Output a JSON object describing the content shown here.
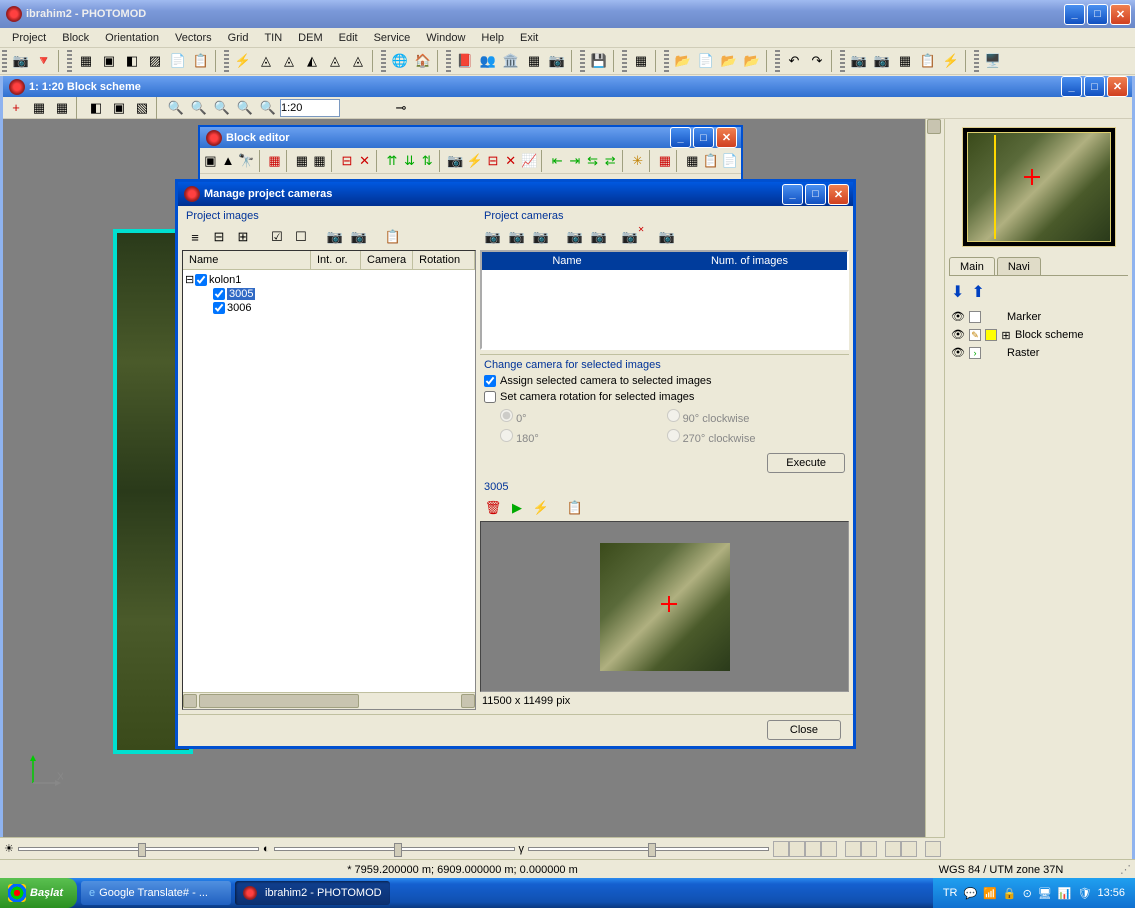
{
  "app": {
    "title": "ibrahim2 - PHOTOMOD"
  },
  "menu": {
    "items": [
      "Project",
      "Block",
      "Orientation",
      "Vectors",
      "Grid",
      "TIN",
      "DEM",
      "Edit",
      "Service",
      "Window",
      "Help",
      "Exit"
    ]
  },
  "block_scheme": {
    "title": "1: 1:20 Block scheme",
    "scale_value": "1:20"
  },
  "block_editor": {
    "title": "Block editor"
  },
  "mpc": {
    "title": "Manage project cameras",
    "left_label": "Project images",
    "tree_headers": [
      "Name",
      "Int. or.",
      "Camera",
      "Rotation"
    ],
    "tree": {
      "kolon": "kolon1",
      "items": [
        "3005",
        "3006"
      ],
      "selected": "3005"
    },
    "right_label": "Project cameras",
    "cam_headers": [
      "Name",
      "Num. of images"
    ],
    "change_label": "Change camera for selected images",
    "assign_label": "Assign selected camera to selected images",
    "setrot_label": "Set camera rotation for selected images",
    "radios": [
      "0°",
      "90° clockwise",
      "180°",
      "270° clockwise"
    ],
    "execute": "Execute",
    "thumb_label": "3005",
    "thumb_dims": "11500 x 11499 pix",
    "close": "Close"
  },
  "side": {
    "tabs": [
      "Main",
      "Navi"
    ],
    "layers": [
      "Marker",
      "Block scheme",
      "Raster"
    ]
  },
  "status": {
    "coords": "* 7959.200000 m; 6909.000000 m; 0.000000 m",
    "proj": "WGS 84 / UTM zone 37N"
  },
  "taskbar": {
    "start": "Başlat",
    "tasks": [
      "Google Translate# - ...",
      "ibrahim2 - PHOTOMOD"
    ],
    "lang": "TR",
    "clock": "13:56"
  }
}
